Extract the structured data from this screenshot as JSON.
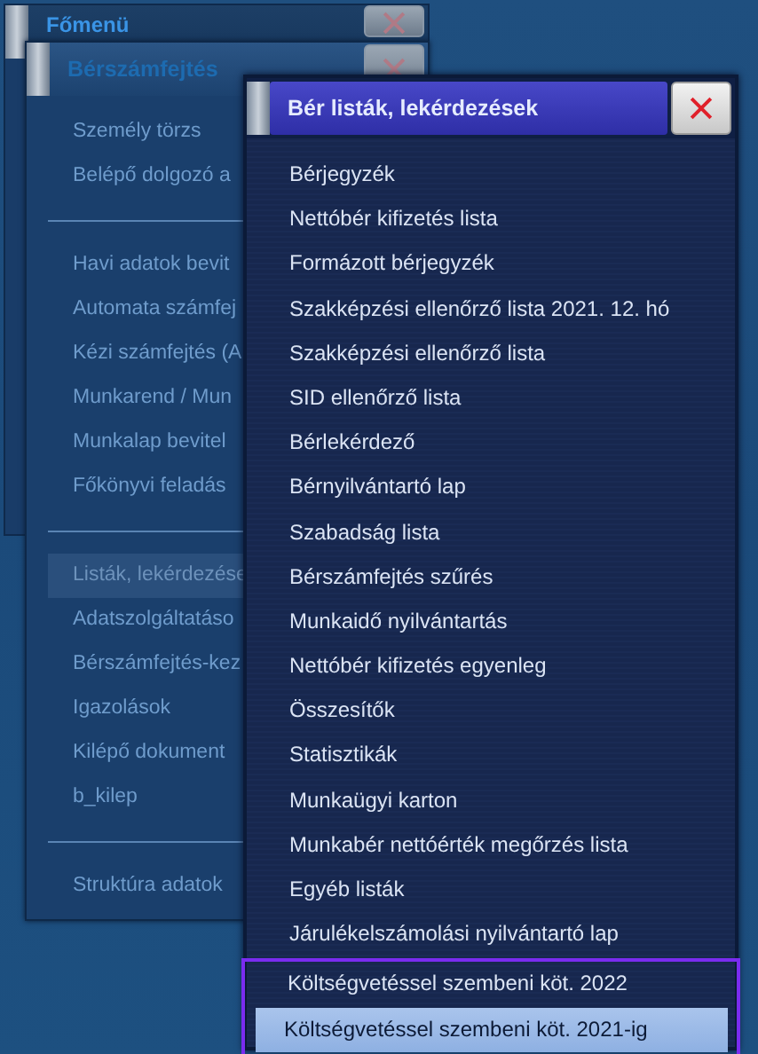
{
  "main_menu": {
    "title": "Főmenü"
  },
  "payroll_menu": {
    "title": "Bérszámfejtés",
    "items": [
      {
        "kind": "item",
        "label": "Személy törzs",
        "selected": false
      },
      {
        "kind": "item",
        "label": "Belépő dolgozó a",
        "selected": false
      },
      {
        "kind": "separator"
      },
      {
        "kind": "item",
        "label": "Havi adatok bevit",
        "selected": false
      },
      {
        "kind": "item",
        "label": "Automata számfej",
        "selected": false
      },
      {
        "kind": "item",
        "label": "Kézi számfejtés (A",
        "selected": false
      },
      {
        "kind": "item",
        "label": "Munkarend / Mun",
        "selected": false
      },
      {
        "kind": "item",
        "label": "Munkalap bevitel",
        "selected": false
      },
      {
        "kind": "item",
        "label": "Főkönyvi feladás",
        "selected": false
      },
      {
        "kind": "separator"
      },
      {
        "kind": "item",
        "label": "Listák, lekérdezése",
        "selected": true
      },
      {
        "kind": "item",
        "label": "Adatszolgáltatáso",
        "selected": false
      },
      {
        "kind": "item",
        "label": "Bérszámfejtés-kez",
        "selected": false
      },
      {
        "kind": "item",
        "label": "Igazolások",
        "selected": false
      },
      {
        "kind": "item",
        "label": "Kilépő dokument",
        "selected": false
      },
      {
        "kind": "item",
        "label": "b_kilep",
        "selected": false
      },
      {
        "kind": "separator"
      },
      {
        "kind": "item",
        "label": "Struktúra adatok",
        "selected": false
      }
    ]
  },
  "dialog": {
    "title": "Bér listák, lekérdezések",
    "items": [
      {
        "label": "Bérjegyzék",
        "selected": false,
        "framed": false
      },
      {
        "label": "Nettóbér kifizetés lista",
        "selected": false,
        "framed": false
      },
      {
        "label": "Formázott bérjegyzék",
        "selected": false,
        "framed": false
      },
      {
        "label": "Szakképzési ellenőrző lista 2021. 12. hó",
        "selected": false,
        "framed": false
      },
      {
        "label": "Szakképzési ellenőrző lista",
        "selected": false,
        "framed": false
      },
      {
        "label": "SID ellenőrző lista",
        "selected": false,
        "framed": false
      },
      {
        "label": "Bérlekérdező",
        "selected": false,
        "framed": false
      },
      {
        "label": "Bérnyilvántartó lap",
        "selected": false,
        "framed": false
      },
      {
        "label": "Szabadság lista",
        "selected": false,
        "framed": false
      },
      {
        "label": "Bérszámfejtés szűrés",
        "selected": false,
        "framed": false
      },
      {
        "label": "Munkaidő nyilvántartás",
        "selected": false,
        "framed": false
      },
      {
        "label": "Nettóbér kifizetés egyenleg",
        "selected": false,
        "framed": false
      },
      {
        "label": "Összesítők",
        "selected": false,
        "framed": false
      },
      {
        "label": "Statisztikák",
        "selected": false,
        "framed": false
      },
      {
        "label": "Munkaügyi karton",
        "selected": false,
        "framed": false
      },
      {
        "label": "Munkabér nettóérték megőrzés lista",
        "selected": false,
        "framed": false
      },
      {
        "label": "Egyéb listák",
        "selected": false,
        "framed": false
      },
      {
        "label": "Járulékelszámolási nyilvántartó lap",
        "selected": false,
        "framed": false
      },
      {
        "label": "Költségvetéssel szembeni köt. 2022",
        "selected": false,
        "framed": true
      },
      {
        "label": "Költségvetéssel szembeni köt. 2021-ig",
        "selected": true,
        "framed": true
      }
    ]
  }
}
